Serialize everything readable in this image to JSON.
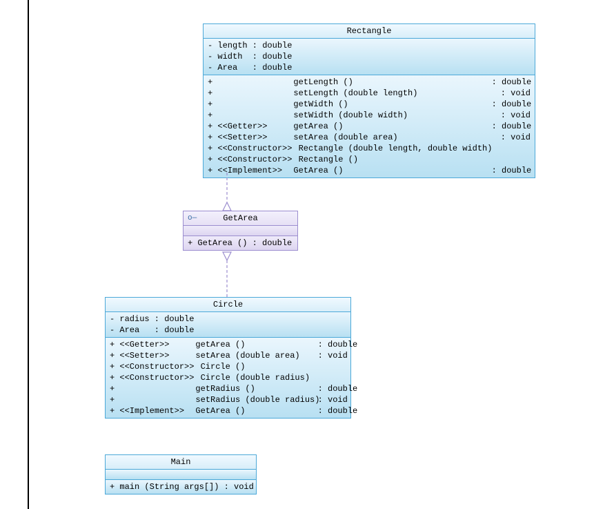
{
  "rect": {
    "title": "Rectangle",
    "attrs": [
      {
        "v": "- ",
        "n": "length",
        "t": "double"
      },
      {
        "v": "- ",
        "n": "width ",
        "t": "double"
      },
      {
        "v": "- ",
        "n": "Area  ",
        "t": "double"
      }
    ],
    "ops": [
      {
        "v": "+ ",
        "st": "               ",
        "sig": "getLength ()",
        "rt": " : double"
      },
      {
        "v": "+ ",
        "st": "               ",
        "sig": "setLength (double length)",
        "rt": " : void"
      },
      {
        "v": "+ ",
        "st": "               ",
        "sig": "getWidth ()",
        "rt": " : double"
      },
      {
        "v": "+ ",
        "st": "               ",
        "sig": "setWidth (double width)",
        "rt": " : void"
      },
      {
        "v": "+ ",
        "st": "<<Getter>>     ",
        "sig": "getArea ()",
        "rt": " : double"
      },
      {
        "v": "+ ",
        "st": "<<Setter>>     ",
        "sig": "setArea (double area)",
        "rt": " : void"
      },
      {
        "v": "+ ",
        "st": "<<Constructor>>",
        "sig": " Rectangle (double length, double width)",
        "rt": ""
      },
      {
        "v": "+ ",
        "st": "<<Constructor>>",
        "sig": " Rectangle ()",
        "rt": ""
      },
      {
        "v": "+ ",
        "st": "<<Implement>>  ",
        "sig": "GetArea ()",
        "rt": " : double"
      }
    ]
  },
  "iface": {
    "title": "GetArea",
    "ops": [
      {
        "v": "+ ",
        "sig": "GetArea () : double"
      }
    ]
  },
  "circle": {
    "title": "Circle",
    "attrs": [
      {
        "v": "- ",
        "n": "radius",
        "t": "double"
      },
      {
        "v": "- ",
        "n": "Area  ",
        "t": "double"
      }
    ],
    "ops": [
      {
        "v": "+ ",
        "st": "<<Getter>>     ",
        "sig": "getArea ()",
        "rt": " : double"
      },
      {
        "v": "+ ",
        "st": "<<Setter>>     ",
        "sig": "setArea (double area)",
        "rt": " : void"
      },
      {
        "v": "+ ",
        "st": "<<Constructor>>",
        "sig": " Circle ()",
        "rt": ""
      },
      {
        "v": "+ ",
        "st": "<<Constructor>>",
        "sig": " Circle (double radius)",
        "rt": ""
      },
      {
        "v": "+ ",
        "st": "               ",
        "sig": "getRadius ()",
        "rt": " : double"
      },
      {
        "v": "+ ",
        "st": "               ",
        "sig": "setRadius (double radius)",
        "rt": " : void"
      },
      {
        "v": "+ ",
        "st": "<<Implement>>  ",
        "sig": "GetArea ()",
        "rt": " : double"
      }
    ]
  },
  "main": {
    "title": "Main",
    "ops": [
      {
        "v": "+ ",
        "sig": "main (String args[]) : void"
      }
    ]
  },
  "lollipop": "o—"
}
